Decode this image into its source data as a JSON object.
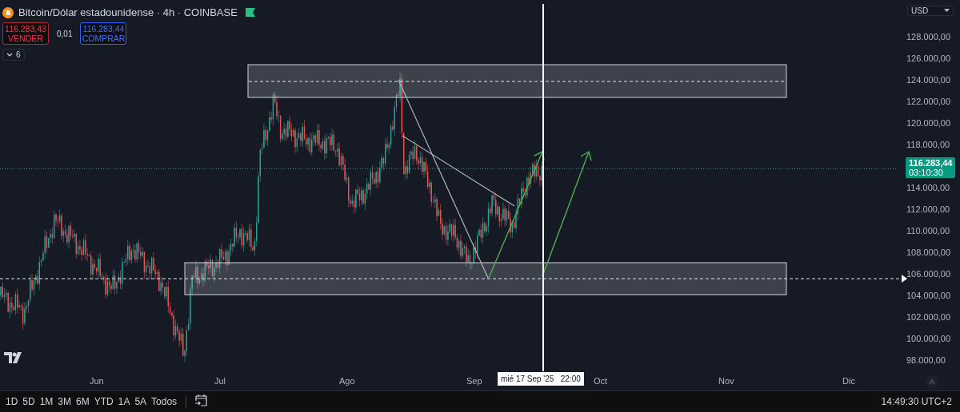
{
  "header": {
    "title": "Bitcoin/Dólar estadounidense · 4h · COINBASE",
    "sell": {
      "price": "116.283,43",
      "label": "VENDER"
    },
    "spread": "0,01",
    "buy": {
      "price": "116.283,44",
      "label": "COMPRAR"
    },
    "indicators_toggle": {
      "count": "6"
    }
  },
  "currency_selector": {
    "value": "USD"
  },
  "price_axis": [
    {
      "kind": "tick",
      "label": "128.000,00"
    },
    {
      "kind": "tick",
      "label": "126.000,00"
    },
    {
      "kind": "tick",
      "label": "124.000,00"
    },
    {
      "kind": "tick",
      "label": "122.000,00"
    },
    {
      "kind": "tick",
      "label": "120.000,00"
    },
    {
      "kind": "tick",
      "label": "118.000,00"
    },
    {
      "kind": "last_price",
      "label": "116.283,44",
      "countdown": "03:10:30"
    },
    {
      "kind": "tick",
      "label": "114.000,00"
    },
    {
      "kind": "tick",
      "label": "112.000,00"
    },
    {
      "kind": "tick",
      "label": "110.000,00"
    },
    {
      "kind": "tick",
      "label": "108.000,00"
    },
    {
      "kind": "tick",
      "label": "106.000,00"
    },
    {
      "kind": "tick",
      "label": "104.000,00"
    },
    {
      "kind": "tick",
      "label": "102.000,00"
    },
    {
      "kind": "tick",
      "label": "100.000,00"
    },
    {
      "kind": "tick",
      "label": "98.000,00"
    }
  ],
  "time_axis": {
    "months": [
      "Jun",
      "Jul",
      "Ago",
      "Sep",
      "Oct",
      "Nov",
      "Dic"
    ],
    "crosshair_label": "mié 17 Sep '25   22:00",
    "auto_scale": "A"
  },
  "range_bar": {
    "ranges": [
      "1D",
      "5D",
      "1M",
      "3M",
      "6M",
      "YTD",
      "1A",
      "5A",
      "Todos"
    ],
    "clock": "14:49:30 UTC+2"
  }
}
